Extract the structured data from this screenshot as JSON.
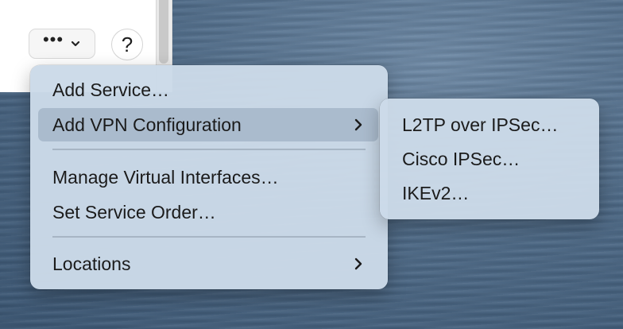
{
  "toolbar": {
    "more_dots": "•••",
    "help_label": "?"
  },
  "menu": {
    "items": [
      {
        "label": "Add Service…"
      },
      {
        "label": "Add VPN Configuration",
        "has_submenu": true,
        "highlighted": true
      },
      {
        "label": "Manage Virtual Interfaces…"
      },
      {
        "label": "Set Service Order…"
      },
      {
        "label": "Locations",
        "has_submenu": true
      }
    ]
  },
  "submenu": {
    "items": [
      {
        "label": "L2TP over IPSec…"
      },
      {
        "label": "Cisco IPSec…"
      },
      {
        "label": "IKEv2…"
      }
    ]
  },
  "colors": {
    "menu_background": "#cbdae8",
    "highlight": "#a0b2c4",
    "text": "#1b1b1b"
  },
  "icons": {
    "more": "ellipsis-icon",
    "dropdown": "chevron-down-icon",
    "help": "question-mark-icon",
    "submenu": "chevron-right-icon"
  }
}
